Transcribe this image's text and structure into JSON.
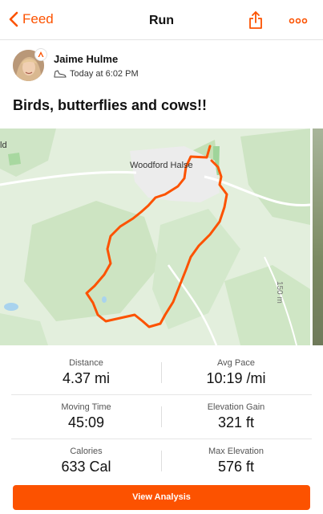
{
  "nav": {
    "back_label": "Feed",
    "title": "Run",
    "share_icon": "share-icon",
    "more_icon": "more-icon",
    "accent": "#fc5200"
  },
  "athlete": {
    "name": "Jaime Hulme",
    "timestamp": "Today at 6:02 PM",
    "activity_icon": "shoe-icon"
  },
  "activity": {
    "title": "Birds, butterflies and cows!!"
  },
  "map": {
    "place_label": "Woodford Halse",
    "edge_label": "ld",
    "contour_label": "150 m",
    "route_color": "#fc5200"
  },
  "stats": [
    [
      {
        "label": "Distance",
        "value": "4.37 mi"
      },
      {
        "label": "Avg Pace",
        "value": "10:19 /mi"
      }
    ],
    [
      {
        "label": "Moving Time",
        "value": "45:09"
      },
      {
        "label": "Elevation Gain",
        "value": "321 ft"
      }
    ],
    [
      {
        "label": "Calories",
        "value": "633 Cal"
      },
      {
        "label": "Max Elevation",
        "value": "576 ft"
      }
    ]
  ],
  "cta": {
    "label": "View Analysis"
  }
}
